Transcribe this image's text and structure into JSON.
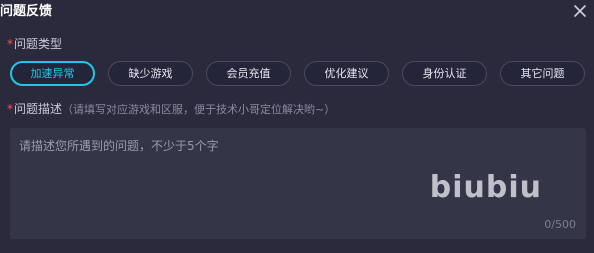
{
  "dialog": {
    "title": "问题反馈",
    "close_icon": "close-icon"
  },
  "issue_type": {
    "required_mark": "*",
    "label": "问题类型",
    "options": [
      {
        "label": "加速异常",
        "selected": true
      },
      {
        "label": "缺少游戏",
        "selected": false
      },
      {
        "label": "会员充值",
        "selected": false
      },
      {
        "label": "优化建议",
        "selected": false
      },
      {
        "label": "身份认证",
        "selected": false
      },
      {
        "label": "其它问题",
        "selected": false
      }
    ]
  },
  "description": {
    "required_mark": "*",
    "label": "问题描述",
    "hint": "（请填写对应游戏和区服，便于技术小哥定位解决哟~）",
    "placeholder": "请描述您所遇到的问题，不少于5个字",
    "value": "",
    "watermark": "biubiu",
    "counter": "0/500"
  },
  "colors": {
    "background": "#2a2a3c",
    "accent": "#20c7e8",
    "required": "#ff4d5e",
    "input_bg": "#353548"
  }
}
